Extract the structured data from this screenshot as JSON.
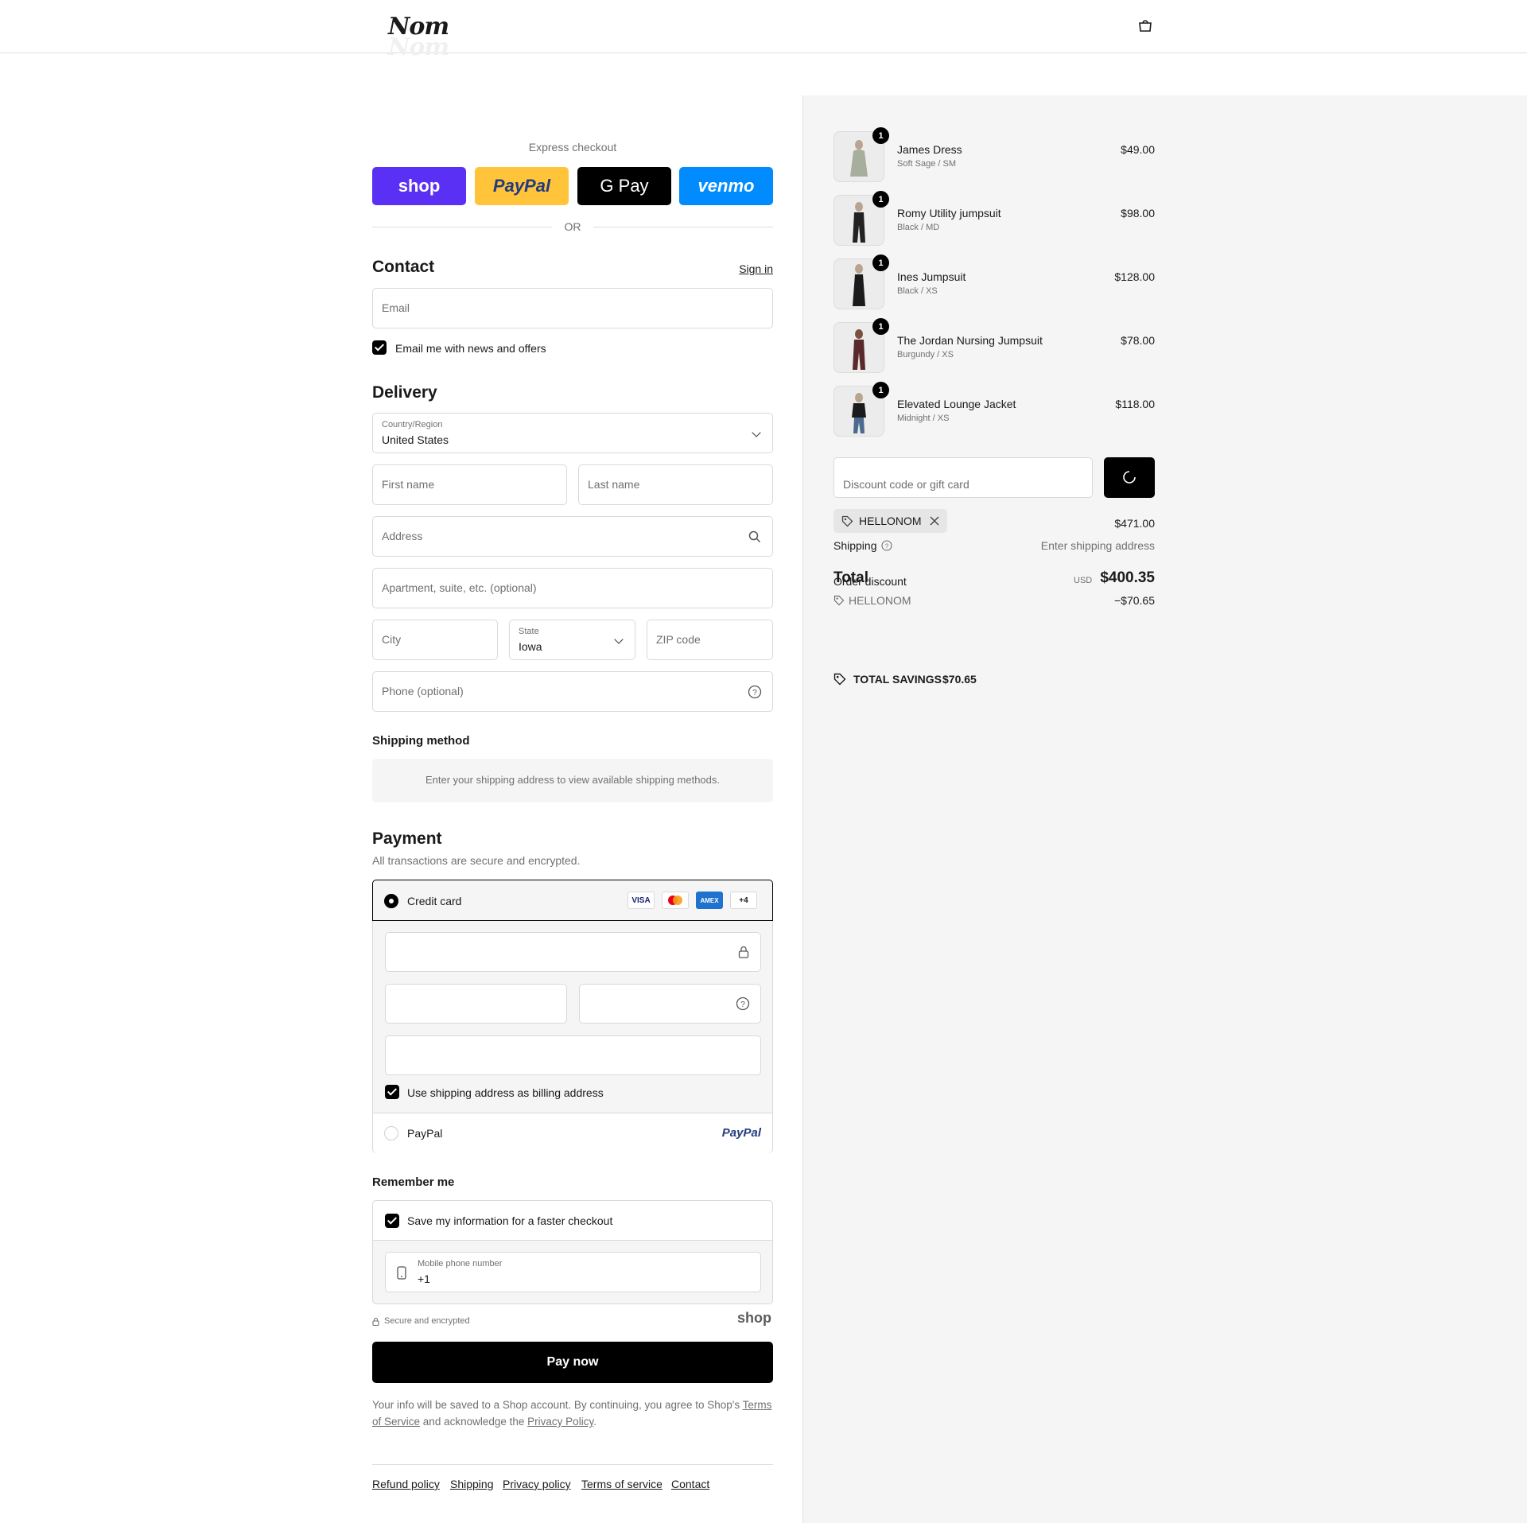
{
  "header": {
    "logo": "Nom"
  },
  "express": {
    "label": "Express checkout",
    "buttons": [
      "shop",
      "PayPal",
      "G Pay",
      "venmo"
    ],
    "or": "OR"
  },
  "contact": {
    "title": "Contact",
    "sign_in": "Sign in",
    "email_placeholder": "Email",
    "news_label": "Email me with news and offers"
  },
  "delivery": {
    "title": "Delivery",
    "country_label": "Country/Region",
    "country_value": "United States",
    "first_name": "First name",
    "last_name": "Last name",
    "address": "Address",
    "apartment": "Apartment, suite, etc. (optional)",
    "city": "City",
    "state_label": "State",
    "state_value": "Iowa",
    "zip": "ZIP code",
    "phone": "Phone (optional)"
  },
  "shipping_method": {
    "title": "Shipping method",
    "message": "Enter your shipping address to view available shipping methods."
  },
  "payment": {
    "title": "Payment",
    "subtitle": "All transactions are secure and encrypted.",
    "credit_card": "Credit card",
    "cards": [
      "VISA",
      "MC",
      "AMEX",
      "+4"
    ],
    "billing_same": "Use shipping address as billing address",
    "paypal": "PayPal",
    "paypal_logo": "PayPal"
  },
  "remember": {
    "title": "Remember me",
    "save_label": "Save my information for a faster checkout",
    "mobile_label": "Mobile phone number",
    "mobile_value": "+1",
    "secure": "Secure and encrypted",
    "shop_logo": "shop"
  },
  "pay_now": "Pay now",
  "legal": {
    "text1": "Your info will be saved to a Shop account. By continuing, you agree to Shop's",
    "terms": "Terms of Service",
    "and": "and acknowledge the",
    "privacy": "Privacy Policy",
    "dot": "."
  },
  "footer": [
    "Refund policy",
    "Shipping",
    "Privacy policy",
    "Terms of service",
    "Contact"
  ],
  "cart": {
    "items": [
      {
        "name": "James Dress",
        "variant": "Soft Sage / SM",
        "price": "$49.00",
        "qty": "1"
      },
      {
        "name": "Romy Utility jumpsuit",
        "variant": "Black / MD",
        "price": "$98.00",
        "qty": "1"
      },
      {
        "name": "Ines Jumpsuit",
        "variant": "Black / XS",
        "price": "$128.00",
        "qty": "1"
      },
      {
        "name": "The Jordan Nursing Jumpsuit",
        "variant": "Burgundy / XS",
        "price": "$78.00",
        "qty": "1"
      },
      {
        "name": "Elevated Lounge Jacket",
        "variant": "Midnight / XS",
        "price": "$118.00",
        "qty": "1"
      }
    ],
    "discount_placeholder": "Discount code or gift card",
    "code": "HELLONOM",
    "subtotal": "$471.00",
    "shipping_label": "Shipping",
    "shipping_value": "Enter shipping address",
    "total_label": "Total",
    "order_discount": "Order discount",
    "currency": "USD",
    "total": "$400.35",
    "discount_code": "HELLONOM",
    "discount_amount": "−$70.65",
    "savings_label": "TOTAL SAVINGS",
    "savings_value": "$70.65"
  }
}
